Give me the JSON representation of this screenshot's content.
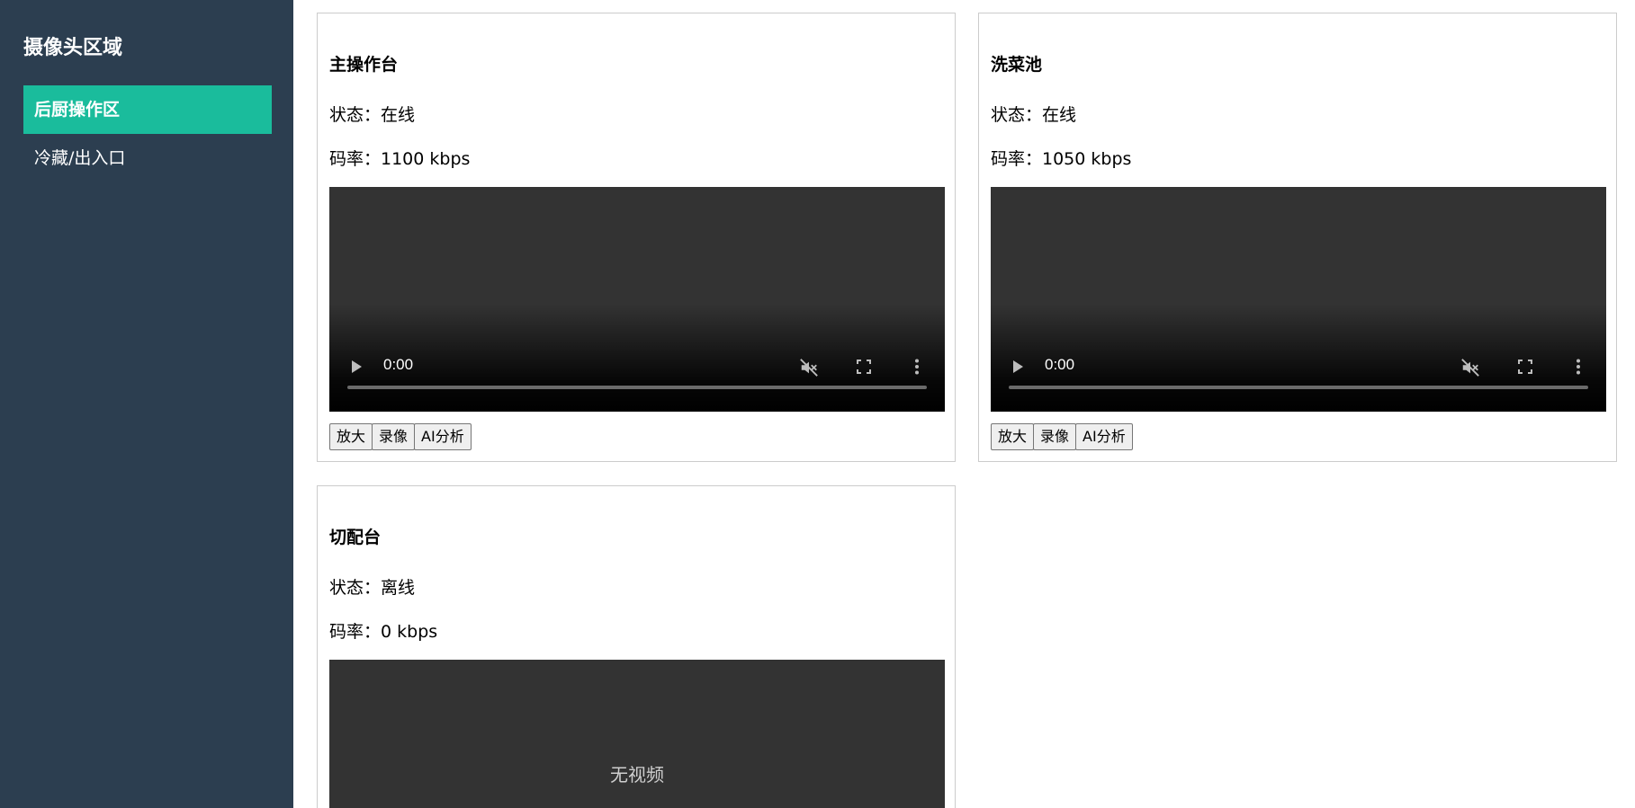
{
  "sidebar": {
    "title": "摄像头区域",
    "items": [
      {
        "label": "后厨操作区",
        "active": true
      },
      {
        "label": "冷藏/出入口",
        "active": false
      }
    ]
  },
  "cameras": [
    {
      "name": "主操作台",
      "status": "状态：在线",
      "bitrate": "码率：1100 kbps",
      "video_time": "0:00",
      "buttons": [
        "放大",
        "录像",
        "AI分析"
      ]
    },
    {
      "name": "洗菜池",
      "status": "状态：在线",
      "bitrate": "码率：1050 kbps",
      "video_time": "0:00",
      "buttons": [
        "放大",
        "录像",
        "AI分析"
      ]
    },
    {
      "name": "切配台",
      "status": "状态：离线",
      "bitrate": "码率：0 kbps",
      "no_video": "无视频"
    }
  ],
  "colors": {
    "sidebar_bg": "#2c3e50",
    "active_item": "#1abc9c",
    "video_bg": "#333333"
  },
  "icons": {
    "play": "play-icon",
    "mute": "mute-icon",
    "fullscreen": "fullscreen-icon",
    "more": "more-vertical-icon"
  }
}
